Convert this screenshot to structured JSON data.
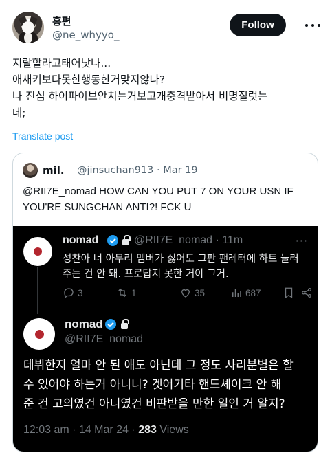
{
  "author": {
    "name": "홍편",
    "handle": "@ne_whyyo_"
  },
  "follow_button": "Follow",
  "tweet": {
    "lines": [
      "지랄할라고태어낫나...",
      "애새키보다못한행동한거맞지않나?",
      "나 진심 하이파이브안치는거보고개충격받아서 비명질럿는",
      "데;"
    ],
    "translate_label": "Translate post"
  },
  "quote": {
    "name": "mil.",
    "handle": "@jinsuchan913",
    "separator": "·",
    "date": "Mar 19",
    "text_lines": [
      "@RII7E_nomad HOW CAN YOU PUT 7 ON YOUR USN IF",
      "YOU'RE SUNGCHAN ANTI?! FCK U"
    ]
  },
  "screenshot": {
    "reply1": {
      "name": "nomad",
      "handle": "@RII7E_nomad",
      "separator": "·",
      "time": "11m",
      "more": "···",
      "text_lines": [
        "성찬아 너 아무리 멤버가 싫어도 그판 팬레터에 하트 눌러",
        "주는 건 안 돼. 프로답지 못한 거야 그거."
      ],
      "replies": "3",
      "retweets": "1",
      "likes": "35",
      "views": "687"
    },
    "reply2": {
      "name": "nomad",
      "handle": "@RII7E_nomad",
      "text_lines": [
        "데뷔한지 얼마 안 된 애도 아닌데 그 정도 사리분별은 할",
        "수 있어야 하는거 아니니? 겟어기타 핸드셰이크 안 해",
        "준 건 고의였건 아니였건 비판받을 만한 일인 거 알지?"
      ],
      "timestamp": "12:03 am · 14 Mar 24 ·",
      "views_count": "283",
      "views_label": "Views"
    }
  },
  "colors": {
    "accent": "#1d9bf0",
    "text": "#0f1419",
    "muted": "#536471",
    "border": "#cfd9de",
    "dark_bg": "#000000",
    "badge_red": "#b3262e"
  }
}
